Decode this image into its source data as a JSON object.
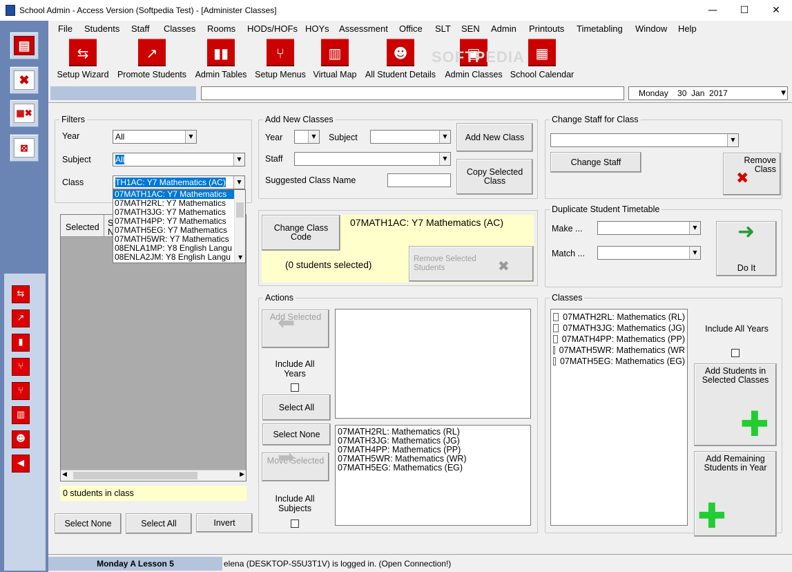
{
  "window": {
    "title": "School Admin - Access Version (Softpedia Test) - [Administer Classes]",
    "minimize": "—",
    "maximize": "☐",
    "close": "✕"
  },
  "menu": [
    "File",
    "Students",
    "Staff",
    "Classes",
    "Rooms",
    "HODs/HOFs",
    "HOYs",
    "Assessment",
    "Office",
    "SLT",
    "SEN",
    "Admin",
    "Printouts",
    "Timetabling",
    "Window",
    "Help"
  ],
  "toolbar": [
    {
      "label": "Setup Wizard",
      "icon": "signpost-icon"
    },
    {
      "label": "Promote Students",
      "icon": "promote-icon"
    },
    {
      "label": "Admin Tables",
      "icon": "bar-chart-icon"
    },
    {
      "label": "Setup Menus",
      "icon": "flow-icon"
    },
    {
      "label": "Virtual Map",
      "icon": "map-icon"
    },
    {
      "label": "All Student Details",
      "icon": "person-icon"
    },
    {
      "label": "Admin Classes",
      "icon": "book-icon"
    },
    {
      "label": "School Calendar",
      "icon": "calendar-icon"
    }
  ],
  "watermark": "SOFTPEDIA",
  "datebar": {
    "date": "Monday    30  Jan  2017"
  },
  "filters": {
    "legend": "Filters",
    "year_label": "Year",
    "year_value": "All",
    "subject_label": "Subject",
    "subject_value": "All",
    "class_label": "Class",
    "class_value": "TH1AC:  Y7 Mathematics (AC)",
    "class_options": [
      "07MATH1AC:  Y7 Mathematics",
      "07MATH2RL:  Y7 Mathematics",
      "07MATH3JG:  Y7 Mathematics",
      "07MATH4PP:  Y7 Mathematics",
      "07MATH5EG:  Y7 Mathematics",
      "07MATH5WR:  Y7 Mathematics",
      "08ENLA1MP:  Y8 English Langu",
      "08ENLA2JM:  Y8 English Langu"
    ]
  },
  "students": {
    "col_selected": "Selected",
    "col_s": "S",
    "col_n": "N",
    "count_text": "0 students in class",
    "select_none": "Select None",
    "select_all": "Select All",
    "invert": "Invert"
  },
  "add_classes": {
    "legend": "Add New Classes",
    "year_label": "Year",
    "subject_label": "Subject",
    "staff_label": "Staff",
    "suggested_label": "Suggested Class Name",
    "add_button": "Add New Class",
    "copy_button": "Copy Selected Class"
  },
  "change_staff": {
    "legend": "Change Staff for Class",
    "change_button": "Change Staff",
    "remove_button": "Remove Class"
  },
  "class_info": {
    "change_code_button": "Change Class Code",
    "current_class": "07MATH1AC:  Y7 Mathematics (AC)",
    "selected_text": "(0 students selected)",
    "remove_students_button": "Remove Selected Students"
  },
  "duplicate": {
    "legend": "Duplicate Student Timetable",
    "make_label": "Make ...",
    "match_label": "Match ...",
    "do_it_button": "Do It"
  },
  "actions": {
    "legend": "Actions",
    "add_selected": "Add Selected",
    "include_all_years": "Include All Years",
    "select_all": "Select All",
    "select_none": "Select None",
    "move_selected": "Move Selected",
    "include_all_subjects": "Include All Subjects",
    "list": [
      "07MATH2RL: Mathematics (RL)",
      "07MATH3JG: Mathematics (JG)",
      "07MATH4PP: Mathematics (PP)",
      "07MATH5WR: Mathematics (WR)",
      "07MATH5EG: Mathematics (EG)"
    ]
  },
  "classes": {
    "legend": "Classes",
    "list": [
      "07MATH2RL: Mathematics (RL)",
      "07MATH3JG: Mathematics (JG)",
      "07MATH4PP: Mathematics (PP)",
      "07MATH5WR: Mathematics (WR",
      "07MATH5EG: Mathematics (EG)"
    ],
    "include_all_years": "Include All Years",
    "add_in_selected": "Add Students in Selected Classes",
    "add_remaining": "Add Remaining Students in Year"
  },
  "status": {
    "lesson": "Monday A Lesson 5",
    "login": "elena (DESKTOP-S5U3T1V) is logged in. (Open Connection!)"
  }
}
